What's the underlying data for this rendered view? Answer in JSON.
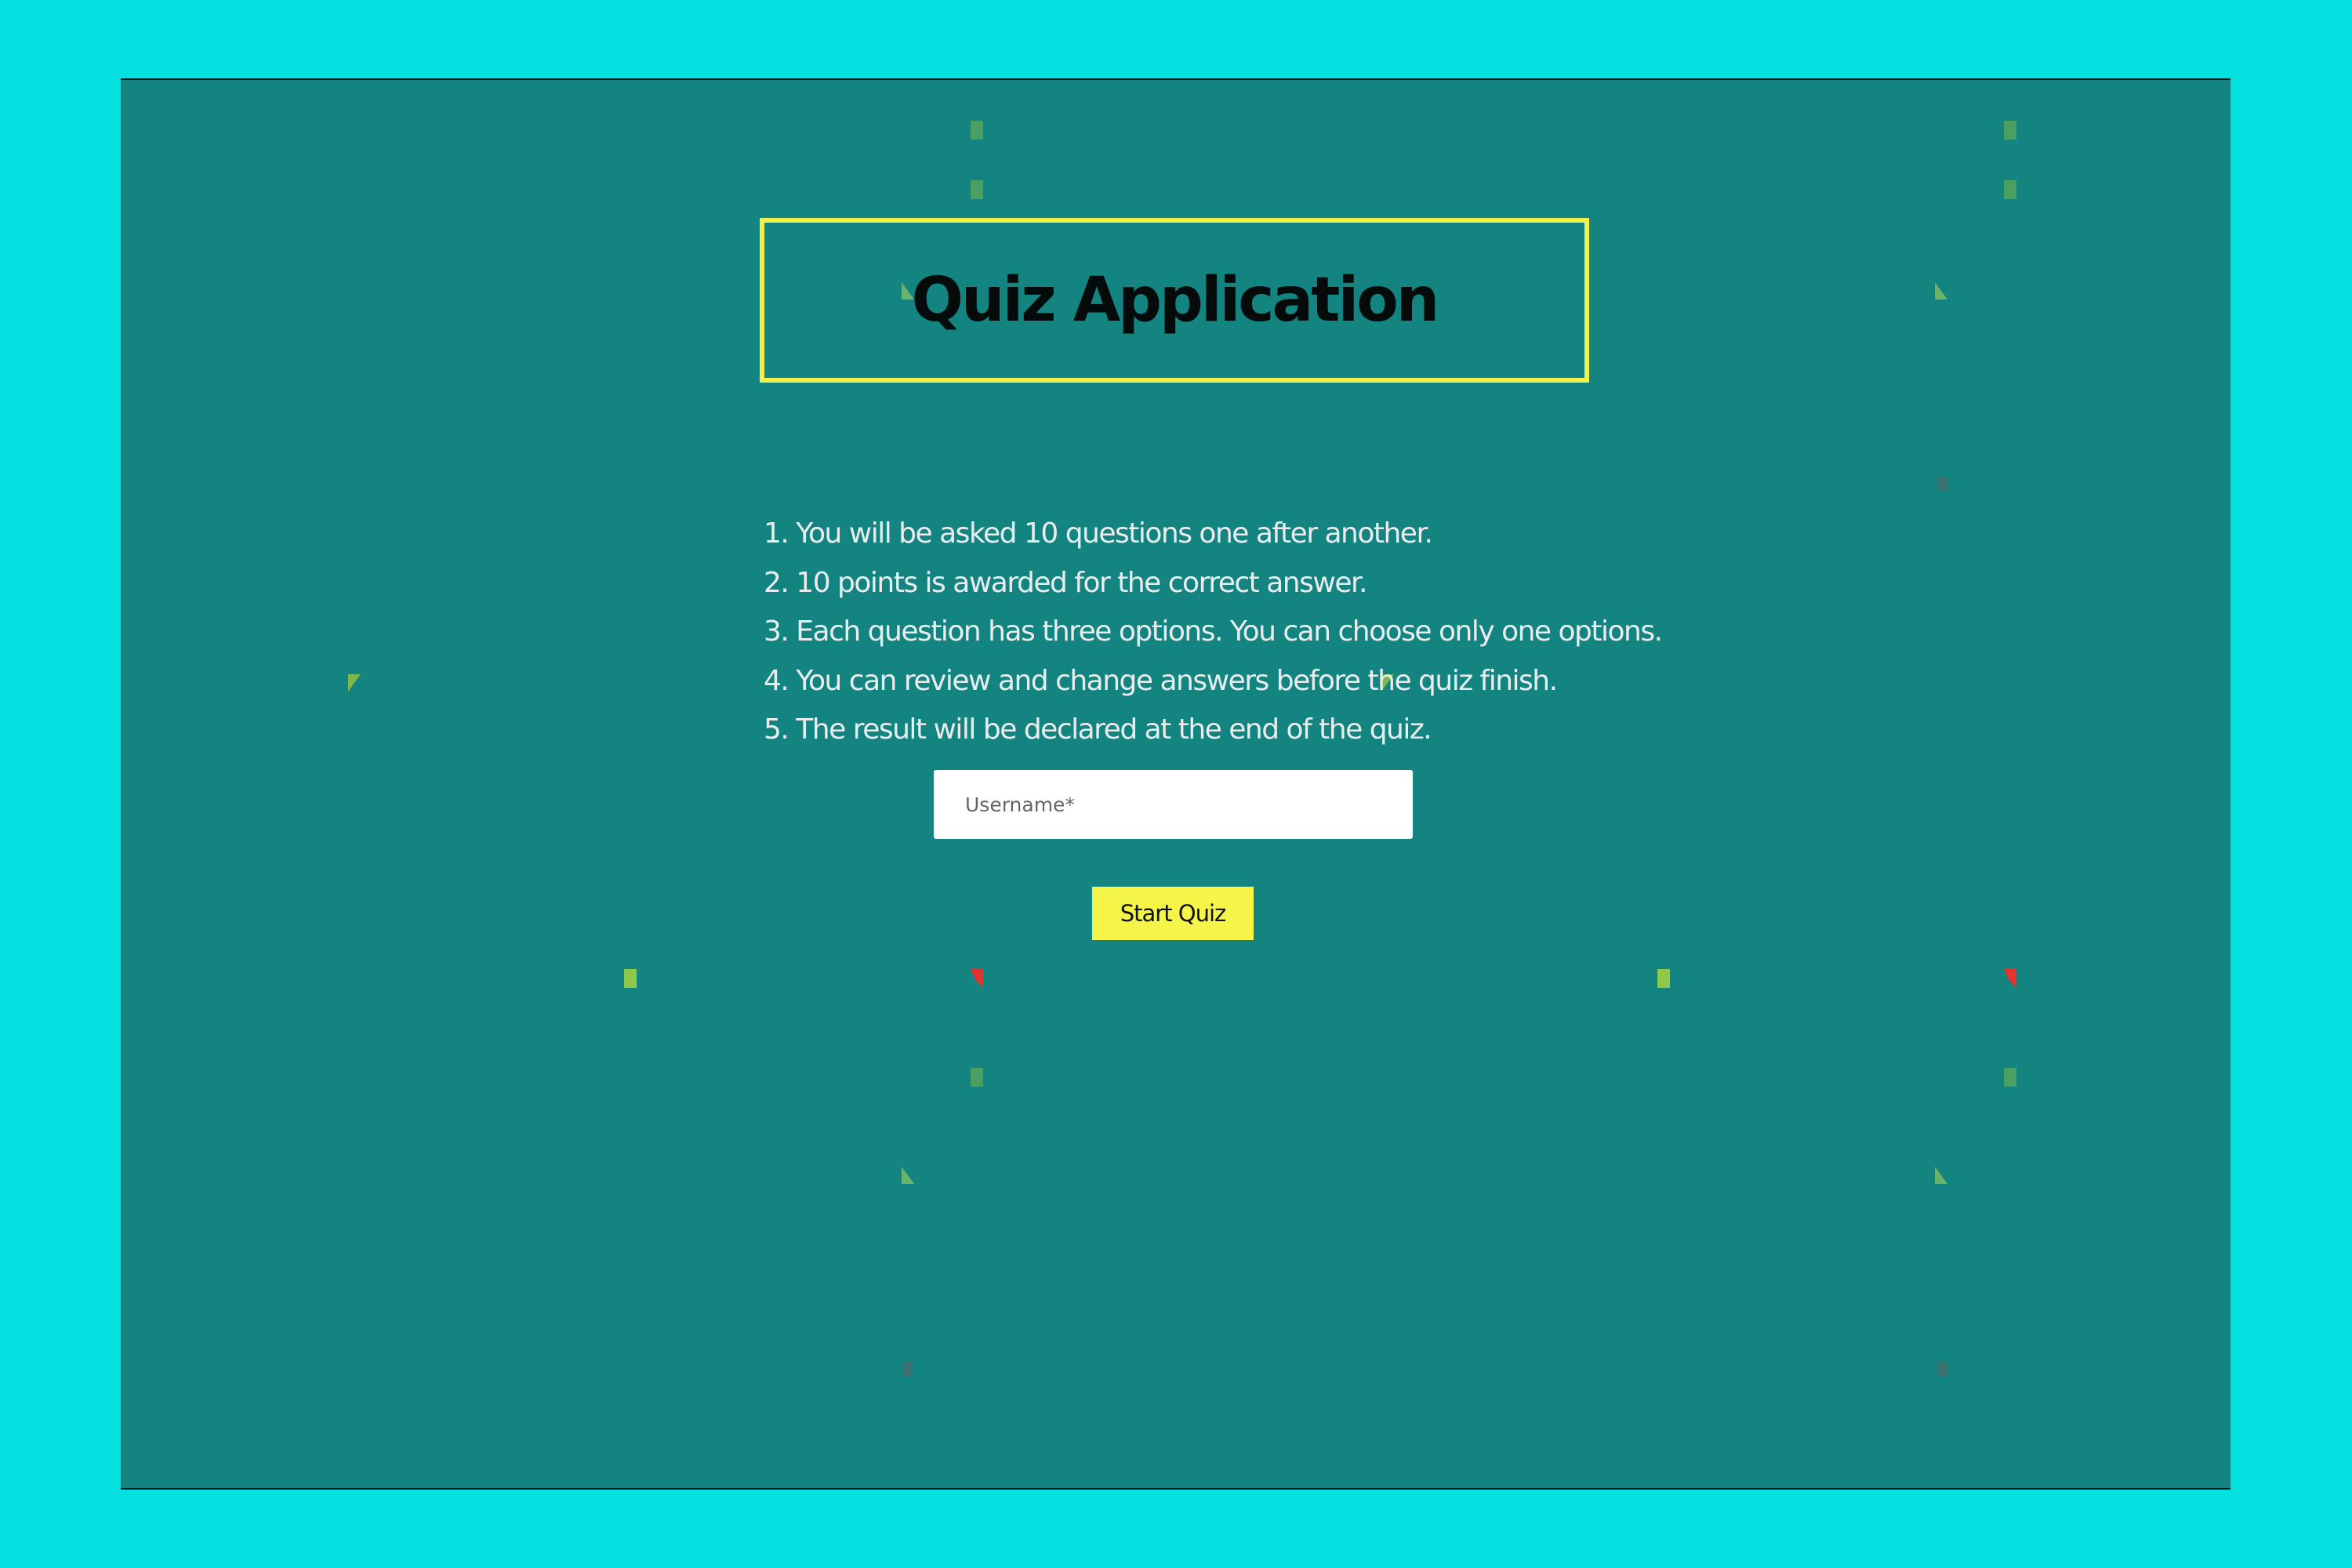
{
  "app": {
    "title": "Quiz Application"
  },
  "rules": [
    "1. You will be asked 10 questions one after another.",
    "2. 10 points is awarded for the correct answer.",
    "3. Each question has three options. You can choose only one options.",
    "4. You can review and change answers before the quiz finish.",
    "5. The result will be declared at the end of the quiz."
  ],
  "form": {
    "username_placeholder": "Username*",
    "username_value": "",
    "start_label": "Start Quiz"
  },
  "colors": {
    "page_background": "#05e0e0",
    "window_background": "#148481",
    "title_border": "#f2f04a",
    "button_background": "#f4f449"
  }
}
